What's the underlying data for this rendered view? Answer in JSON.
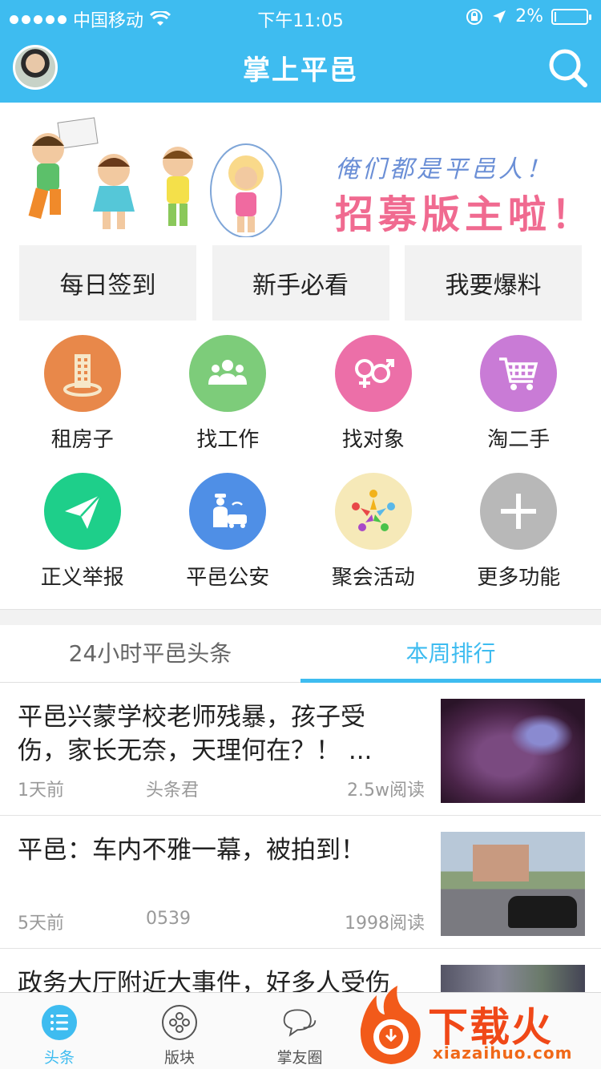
{
  "status_bar": {
    "carrier": "中国移动",
    "time": "下午11:05",
    "battery": "2%",
    "battery_level": 0.02
  },
  "nav": {
    "title": "掌上平邑"
  },
  "banner": {
    "line1": "俺们都是平邑人！",
    "line2": "招募版主啦！"
  },
  "quick_buttons": [
    "每日签到",
    "新手必看",
    "我要爆料"
  ],
  "features": [
    {
      "label": "租房子",
      "icon": "building-icon",
      "color": "#e8884a"
    },
    {
      "label": "找工作",
      "icon": "people-icon",
      "color": "#7dcc7a"
    },
    {
      "label": "找对象",
      "icon": "gender-icon",
      "color": "#ec6fa8"
    },
    {
      "label": "淘二手",
      "icon": "cart-icon",
      "color": "#c97bd6"
    },
    {
      "label": "正义举报",
      "icon": "paper-plane-icon",
      "color": "#1ecf8a"
    },
    {
      "label": "平邑公安",
      "icon": "police-icon",
      "color": "#4f8fe6"
    },
    {
      "label": "聚会活动",
      "icon": "gathering-icon",
      "color": "#f6e9b8"
    },
    {
      "label": "更多功能",
      "icon": "plus-icon",
      "color": "#b8b8b8"
    }
  ],
  "tabs": [
    {
      "label": "24小时平邑头条",
      "active": false
    },
    {
      "label": "本周排行",
      "active": true
    }
  ],
  "news": [
    {
      "title": "平邑兴蒙学校老师残暴，孩子受伤，家长无奈，天理何在？！ ...",
      "time": "1天前",
      "author": "头条君",
      "reads": "2.5w阅读"
    },
    {
      "title": "平邑：车内不雅一幕，被拍到！",
      "time": "5天前",
      "author": "0539",
      "reads": "1998阅读"
    },
    {
      "title": "政务大厅附近大事件，好多人受伤"
    }
  ],
  "tabbar": [
    {
      "label": "头条",
      "icon": "list-icon",
      "active": true
    },
    {
      "label": "版块",
      "icon": "grid-circle-icon",
      "active": false
    },
    {
      "label": "掌友圈",
      "icon": "chat-bubbles-icon",
      "active": false
    }
  ],
  "watermark": {
    "brand": "下载火",
    "url": "xiazaihuo.com"
  }
}
